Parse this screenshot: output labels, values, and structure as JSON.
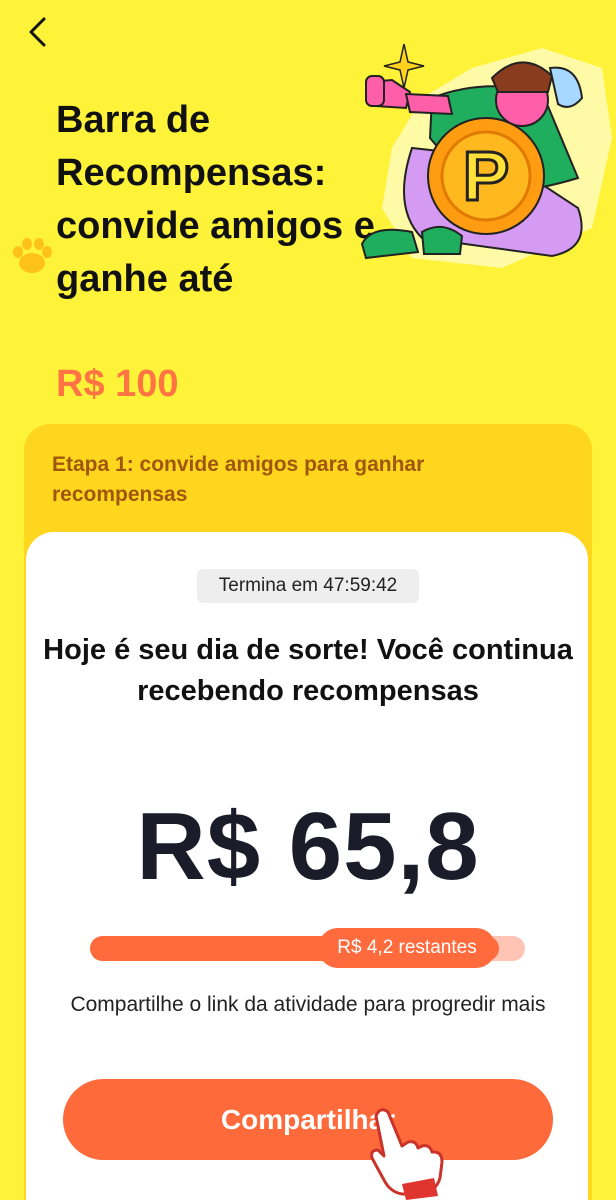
{
  "header": {
    "back_icon": "chevron-left-icon",
    "title": "Barra de Recompensas: convide amigos e ganhe até",
    "max_reward": "R$ 100"
  },
  "step": {
    "title": "Etapa 1: convide amigos para ganhar recompensas"
  },
  "card": {
    "timer": "Termina em 47:59:42",
    "headline": "Hoje é seu dia de sorte! Você continua recebendo recompensas",
    "amount": "R$ 65,8",
    "progress": {
      "fraction": 0.94,
      "label": "R$ 4,2 restantes"
    },
    "share_hint": "Compartilhe o link da atividade para progredir mais",
    "share_button_label": "Compartilhar"
  },
  "colors": {
    "background": "#FFF33A",
    "accent": "#FF6B3D",
    "step_card": "#FFD61E",
    "step_text": "#A0560D"
  },
  "decorations": [
    "paw-icon",
    "reward-illustration",
    "coin-icon",
    "pointing-hand-icon"
  ]
}
